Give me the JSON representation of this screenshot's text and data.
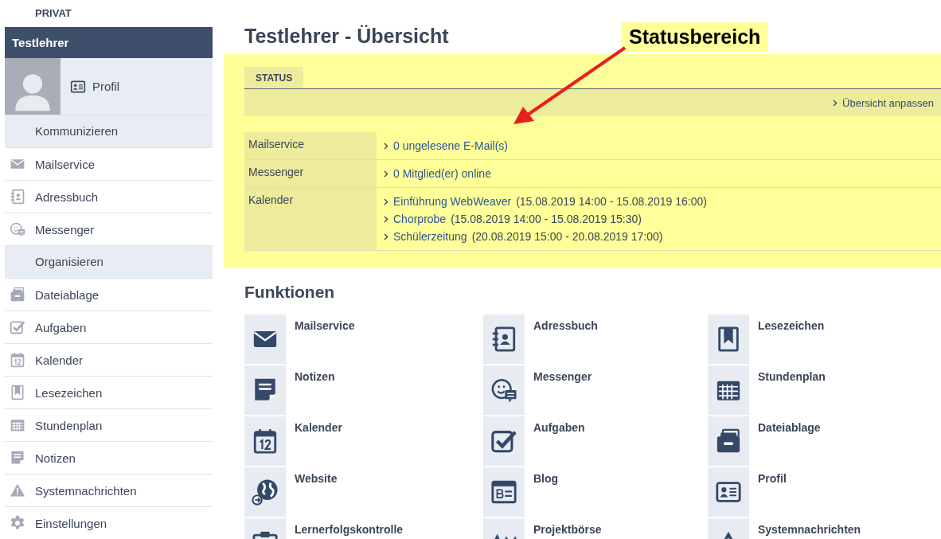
{
  "sidebar": {
    "heading": "PRIVAT",
    "user": "Testlehrer",
    "profile_link": "Profil",
    "items": [
      {
        "kind": "section",
        "label": "Kommunizieren"
      },
      {
        "kind": "link",
        "label": "Mailservice"
      },
      {
        "kind": "link",
        "label": "Adressbuch"
      },
      {
        "kind": "link",
        "label": "Messenger"
      },
      {
        "kind": "section",
        "label": "Organisieren"
      },
      {
        "kind": "link",
        "label": "Dateiablage"
      },
      {
        "kind": "link",
        "label": "Aufgaben"
      },
      {
        "kind": "link",
        "label": "Kalender"
      },
      {
        "kind": "link",
        "label": "Lesezeichen"
      },
      {
        "kind": "link",
        "label": "Stundenplan"
      },
      {
        "kind": "link",
        "label": "Notizen"
      },
      {
        "kind": "link",
        "label": "Systemnachrichten"
      },
      {
        "kind": "link",
        "label": "Einstellungen"
      }
    ]
  },
  "page_title": "Testlehrer - Übersicht",
  "annotation": "Statusbereich",
  "status": {
    "tab": "STATUS",
    "customize_link": "Übersicht anpassen",
    "rows": [
      {
        "label": "Mailservice",
        "entries": [
          {
            "link": "0 ungelesene E-Mail(s)"
          }
        ]
      },
      {
        "label": "Messenger",
        "entries": [
          {
            "link": "0 Mitglied(er) online"
          }
        ]
      },
      {
        "label": "Kalender",
        "entries": [
          {
            "link": "Einführung WebWeaver",
            "detail": "(15.08.2019 14:00 - 15.08.2019 16:00)"
          },
          {
            "link": "Chorprobe",
            "detail": "(15.08.2019 14:00 - 15.08.2019 15:30)"
          },
          {
            "link": "Schülerzeitung",
            "detail": "(20.08.2019 15:00 - 20.08.2019 17:00)"
          }
        ]
      }
    ]
  },
  "functions": {
    "heading": "Funktionen",
    "items": [
      "Mailservice",
      "Adressbuch",
      "Lesezeichen",
      "Notizen",
      "Messenger",
      "Stundenplan",
      "Kalender",
      "Aufgaben",
      "Dateiablage",
      "Website",
      "Blog",
      "Profil",
      "Lernerfolgskontrolle",
      "Projektbörse",
      "Systemnachrichten"
    ]
  }
}
